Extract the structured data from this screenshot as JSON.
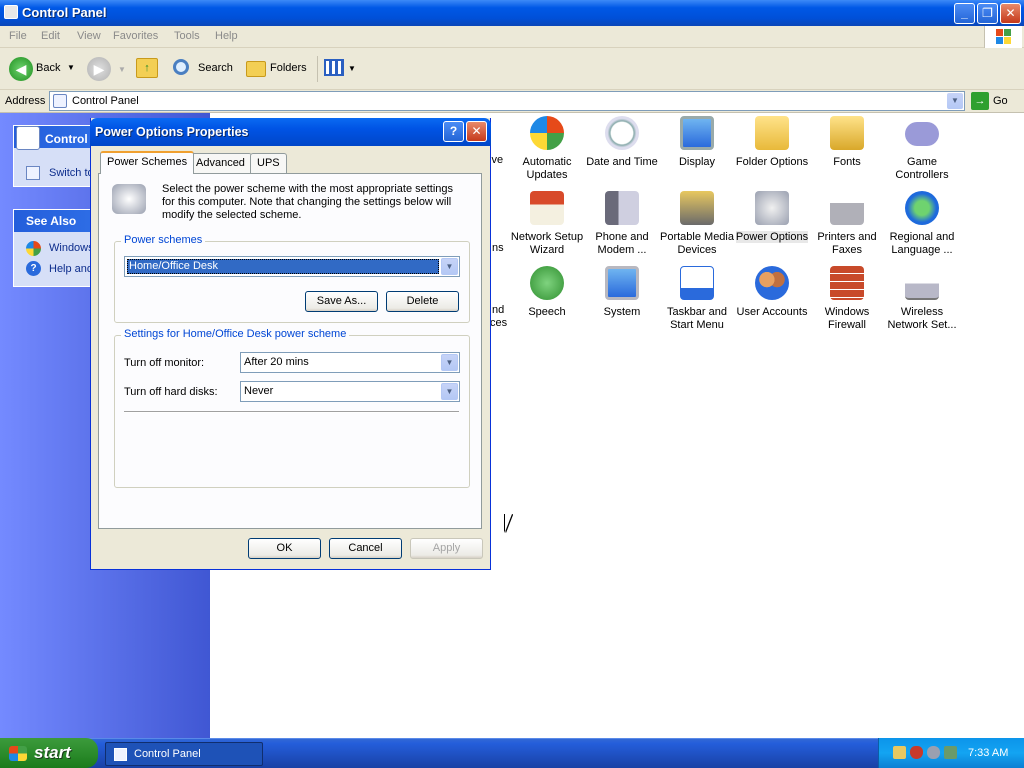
{
  "window": {
    "title": "Control Panel",
    "min": "_",
    "max": "❐",
    "close": "✕"
  },
  "menu": [
    "File",
    "Edit",
    "View",
    "Favorites",
    "Tools",
    "Help"
  ],
  "toolbar": {
    "back": "Back",
    "search": "Search",
    "folders": "Folders"
  },
  "address": {
    "label": "Address",
    "value": "Control Panel",
    "go": "Go"
  },
  "sidebar": {
    "control_title": "Control Panel",
    "switch": "Switch to Category View",
    "see_also": "See Also",
    "items": [
      "Windows Update",
      "Help and Support"
    ]
  },
  "icons": {
    "row1": [
      {
        "label": "Automatic Updates",
        "icon": "shield-icon"
      },
      {
        "label": "Date and Time",
        "icon": "clock-icon"
      },
      {
        "label": "Display",
        "icon": "monitor-icon"
      },
      {
        "label": "Folder Options",
        "icon": "folder-icon"
      },
      {
        "label": "Fonts",
        "icon": "fonts-folder-icon"
      },
      {
        "label": "Game Controllers",
        "icon": "gamepad-icon"
      }
    ],
    "row2": [
      {
        "label": "Network Setup Wizard",
        "icon": "house-network-icon"
      },
      {
        "label": "Phone and Modem ...",
        "icon": "phone-icon"
      },
      {
        "label": "Portable Media Devices",
        "icon": "media-device-icon"
      },
      {
        "label": "Power Options",
        "icon": "power-icon"
      },
      {
        "label": "Printers and Faxes",
        "icon": "printer-icon"
      },
      {
        "label": "Regional and Language ...",
        "icon": "globe-icon"
      }
    ],
    "row3": [
      {
        "label": "Speech",
        "icon": "speech-icon"
      },
      {
        "label": "System",
        "icon": "computer-icon"
      },
      {
        "label": "Taskbar and Start Menu",
        "icon": "taskbar-icon"
      },
      {
        "label": "User Accounts",
        "icon": "users-icon"
      },
      {
        "label": "Windows Firewall",
        "icon": "firewall-icon"
      },
      {
        "label": "Wireless Network Set...",
        "icon": "wireless-icon"
      }
    ],
    "partial": [
      "ive",
      "ns",
      "nd",
      "ces"
    ]
  },
  "dialog": {
    "title": "Power Options Properties",
    "help": "?",
    "close": "✕",
    "tabs": [
      "Power Schemes",
      "Advanced",
      "UPS"
    ],
    "intro": "Select the power scheme with the most appropriate settings for this computer. Note that changing the settings below will modify the selected scheme.",
    "schemes_group": "Power schemes",
    "scheme_value": "Home/Office Desk",
    "save_as": "Save As...",
    "delete": "Delete",
    "settings_group": "Settings for Home/Office Desk power scheme",
    "monitor_label": "Turn off monitor:",
    "monitor_value": "After 20 mins",
    "disks_label": "Turn off hard disks:",
    "disks_value": "Never",
    "ok": "OK",
    "cancel": "Cancel",
    "apply": "Apply"
  },
  "taskbar": {
    "start": "start",
    "task": "Control Panel",
    "clock": "7:33 AM"
  },
  "colors": {
    "xp_blue": "#0058e6",
    "sidebar": "#6375d6",
    "dialog_face": "#ece9d8",
    "group_label": "#0046d5"
  }
}
